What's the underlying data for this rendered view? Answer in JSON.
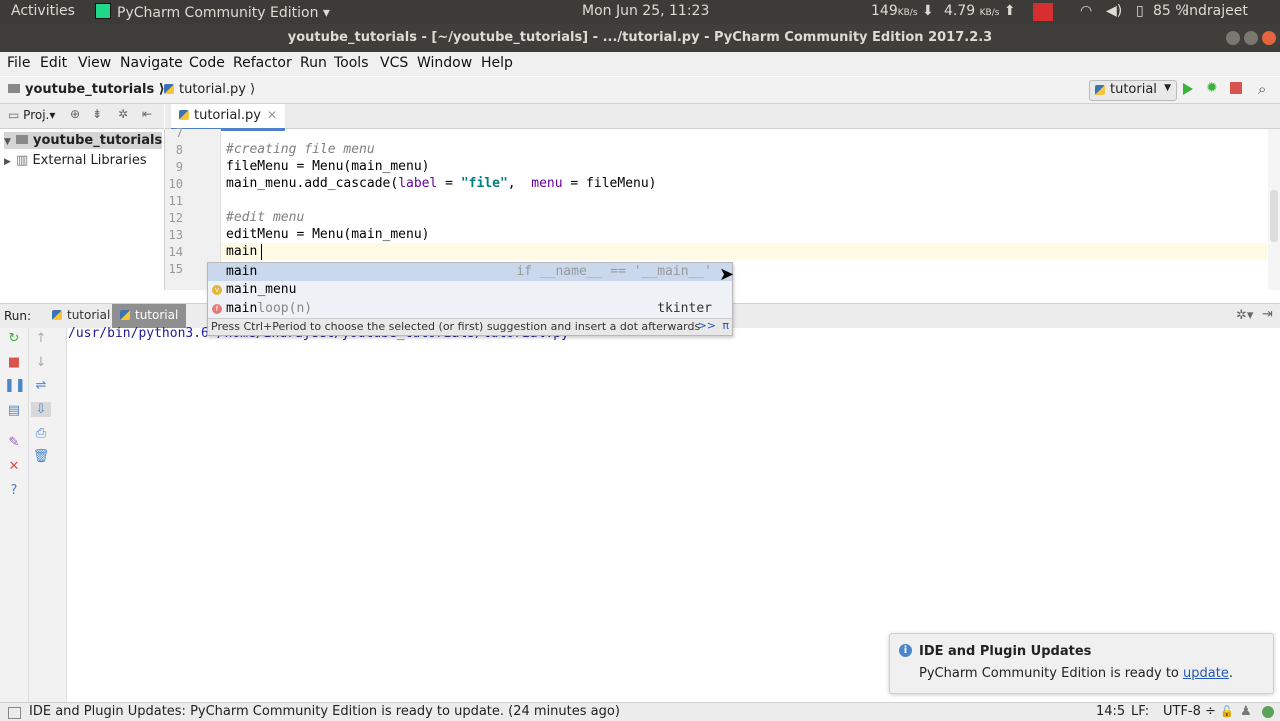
{
  "system_bar": {
    "activities": "Activities",
    "app_name": "PyCharm Community Edition",
    "clock": "Mon Jun 25, 11:23",
    "down_speed": "149",
    "down_unit": "KB/s",
    "up_speed": "4.79",
    "up_unit": "KB/s",
    "battery": "85 %",
    "user": "Indrajeet"
  },
  "window": {
    "title": "youtube_tutorials - [~/youtube_tutorials] - .../tutorial.py - PyCharm Community Edition 2017.2.3"
  },
  "menu": [
    "File",
    "Edit",
    "View",
    "Navigate",
    "Code",
    "Refactor",
    "Run",
    "Tools",
    "VCS",
    "Window",
    "Help"
  ],
  "navbar": {
    "project": "youtube_tutorials",
    "file": "tutorial.py",
    "run_config": "tutorial"
  },
  "project_panel": {
    "header": "Proj.",
    "items": [
      "youtube_tutorials",
      "External Libraries"
    ]
  },
  "editor": {
    "tab": "tutorial.py",
    "line_numbers": [
      "7",
      "8",
      "9",
      "10",
      "11",
      "12",
      "13",
      "14",
      "15"
    ],
    "lines": {
      "l8": "#creating file menu",
      "l9": "fileMenu = Menu(main_menu)",
      "l10_a": "main_menu.add_cascade(",
      "l10_b": "label",
      "l10_c": " = ",
      "l10_d": "\"file\"",
      "l10_e": ",  ",
      "l10_f": "menu",
      "l10_g": " = fileMenu)",
      "l12": "#edit menu",
      "l13": "editMenu = Menu(main_menu)",
      "l14": "main"
    }
  },
  "autocomplete": {
    "items": [
      {
        "match": "main",
        "rest": "",
        "right": "if __name__ == '__main__'"
      },
      {
        "badge": "v",
        "match": "main",
        "rest": "_menu",
        "right": ""
      },
      {
        "badge": "f",
        "match": "main",
        "rest": "loop(n)",
        "right": "tkinter"
      }
    ],
    "hint": "Press Ctrl+Period to choose the selected (or first) suggestion and insert a dot afterwards",
    "hint_link": ">>",
    "hint_pi": "π"
  },
  "run_panel": {
    "label": "Run:",
    "tabs": [
      "tutorial",
      "tutorial"
    ],
    "output": "/usr/bin/python3.6 /home/indrajeet/youtube_tutorials/tutorial.py"
  },
  "notification": {
    "title": "IDE and Plugin Updates",
    "body": "PyCharm Community Edition is ready to ",
    "link": "update",
    "end": "."
  },
  "status_bar": {
    "message": "IDE and Plugin Updates: PyCharm Community Edition is ready to update. (24 minutes ago)",
    "position": "14:5",
    "line_sep": "LF:",
    "encoding": "UTF-8"
  },
  "colors": {
    "accent": "#4f7fcf",
    "comment": "#808080",
    "string": "#008080",
    "keyword_arg": "#660099"
  }
}
